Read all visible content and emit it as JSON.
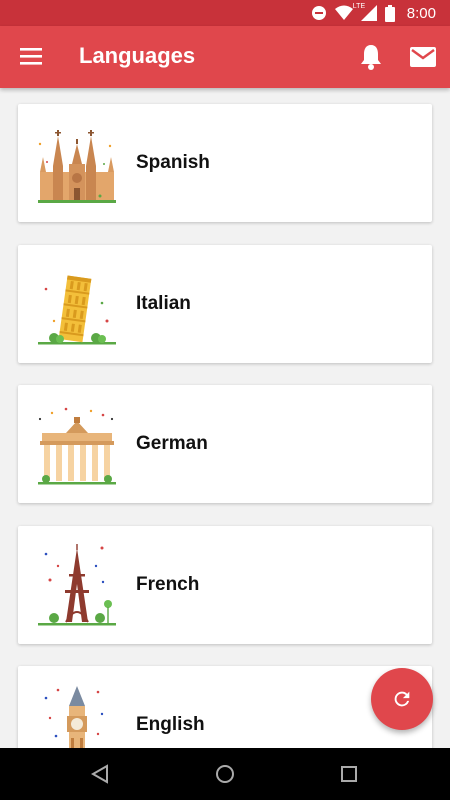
{
  "status_bar": {
    "time": "8:00",
    "network_label": "LTE",
    "icons": [
      "do-not-disturb-icon",
      "wifi-icon",
      "signal-icon",
      "battery-icon"
    ]
  },
  "app_bar": {
    "title": "Languages",
    "menu_icon": "hamburger-menu-icon",
    "actions": [
      "bell-icon",
      "mail-icon"
    ]
  },
  "languages": [
    {
      "name": "Spanish",
      "icon": "cathedral-icon"
    },
    {
      "name": "Italian",
      "icon": "leaning-tower-icon"
    },
    {
      "name": "German",
      "icon": "brandenburg-gate-icon"
    },
    {
      "name": "French",
      "icon": "eiffel-tower-icon"
    },
    {
      "name": "English",
      "icon": "big-ben-icon"
    }
  ],
  "fab": {
    "icon": "refresh-icon"
  },
  "nav_bar": {
    "buttons": [
      "back-icon",
      "home-icon",
      "recents-icon"
    ]
  },
  "colors": {
    "primary": "#e0474c",
    "status_bar": "#c8323a",
    "background": "#f2f2f2",
    "card": "#ffffff"
  }
}
